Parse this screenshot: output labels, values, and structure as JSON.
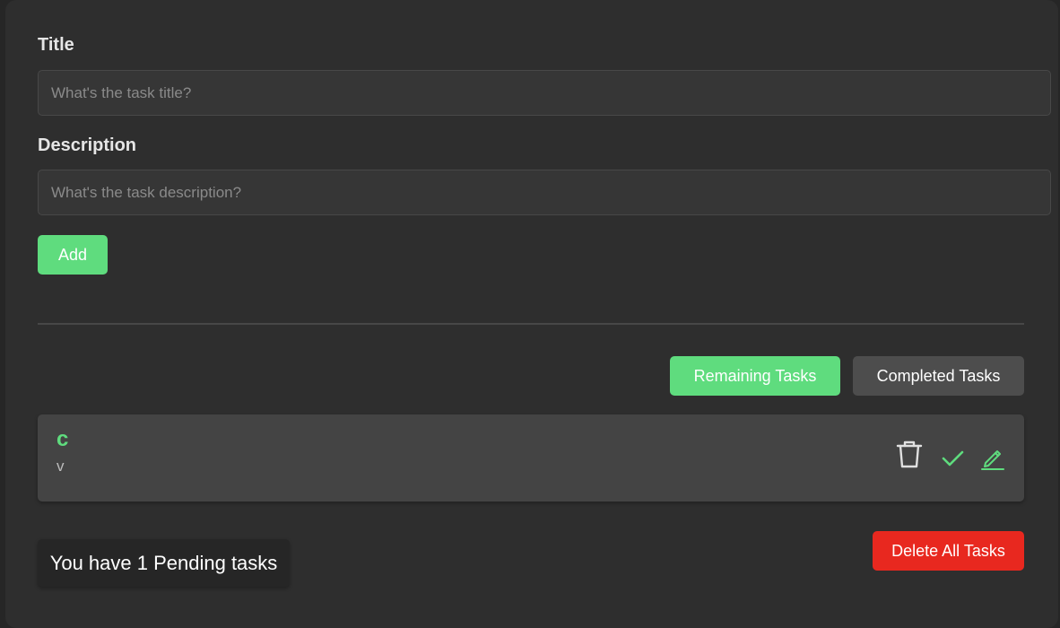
{
  "form": {
    "title_label": "Title",
    "title_placeholder": "What's the task title?",
    "title_value": "",
    "description_label": "Description",
    "description_placeholder": "What's the task description?",
    "description_value": "",
    "add_label": "Add"
  },
  "filters": {
    "remaining_label": "Remaining Tasks",
    "completed_label": "Completed Tasks",
    "active": "Remaining Tasks"
  },
  "tasks": [
    {
      "title": "c",
      "description": "v",
      "actions": [
        "trash-icon",
        "check-icon",
        "pencil-icon"
      ]
    }
  ],
  "footer": {
    "pending_text": "You have 1 Pending tasks",
    "delete_all_label": "Delete All Tasks"
  },
  "colors": {
    "accent_green": "#5fdc7e",
    "danger_red": "#e8281f",
    "background": "#2e2e2e",
    "card": "#444444"
  }
}
